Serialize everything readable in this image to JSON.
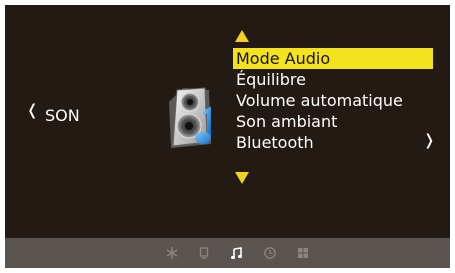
{
  "category": {
    "label": "SON"
  },
  "nav": {
    "left_glyph": "❬",
    "right_glyph": "❭"
  },
  "menu": {
    "items": [
      {
        "label": "Mode Audio",
        "selected": true
      },
      {
        "label": "Équilibre",
        "selected": false
      },
      {
        "label": "Volume automatique",
        "selected": false
      },
      {
        "label": "Son ambiant",
        "selected": false
      },
      {
        "label": "Bluetooth",
        "selected": false
      }
    ]
  },
  "bottom_bar": {
    "icons": [
      "snowflake-icon",
      "monitor-icon",
      "music-note-icon",
      "clock-icon",
      "grid-icon"
    ],
    "active_icon": "music-note-icon"
  },
  "colors": {
    "background": "#221a13",
    "highlight": "#f3e21c",
    "arrow": "#f3d21d",
    "bar": "#5b5552"
  }
}
